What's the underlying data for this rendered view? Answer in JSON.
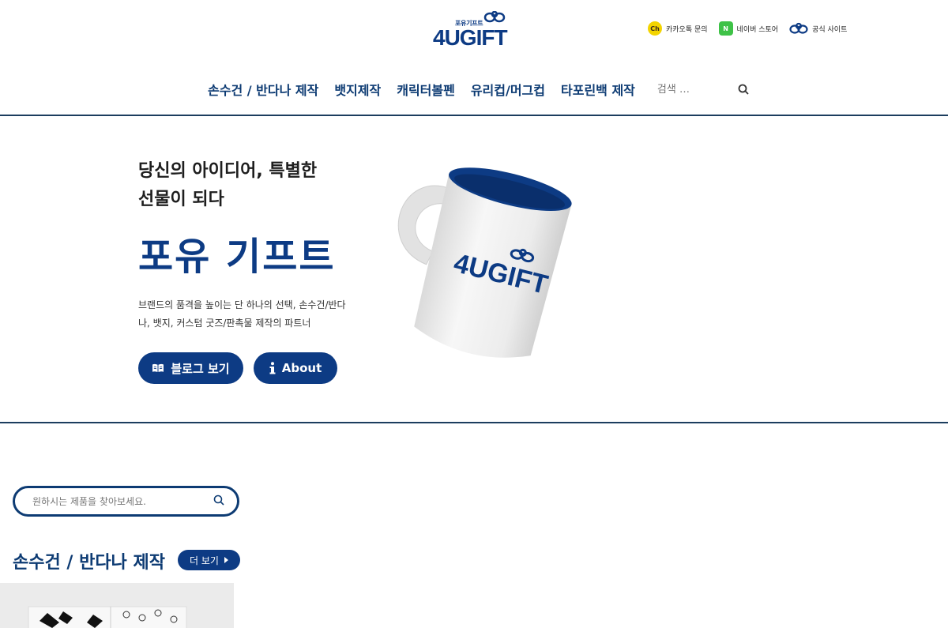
{
  "header": {
    "logo_small": "포유기프트",
    "logo_big": "4UGIFT",
    "top_links": [
      {
        "label": "카카오톡 문의",
        "icon": "kakao-channel-icon"
      },
      {
        "label": "네이버 스토어",
        "icon": "naver-store-icon"
      },
      {
        "label": "공식 사이트",
        "icon": "cloud-logo-icon"
      }
    ],
    "nav": [
      "손수건 / 반다나 제작",
      "뱃지제작",
      "캐릭터볼펜",
      "유리컵/머그컵",
      "타포린백 제작"
    ],
    "search_placeholder": "검색 …"
  },
  "hero": {
    "subtitle_line1": "당신의 아이디어, 특별한",
    "subtitle_line2": "선물이 되다",
    "title": "포유 기프트",
    "desc": "브랜드의 품격을 높이는 단 하나의 선택, 손수건/반다나, 뱃지, 커스텀 굿즈/판촉물 제작의 파트너",
    "btn_blog": "블로그 보기",
    "btn_about": "About",
    "mug_logo": "4UGIFT"
  },
  "product_search": {
    "placeholder": "원하시는 제품을 찾아보세요."
  },
  "section": {
    "title": "손수건 / 반다나 제작",
    "more": "더 보기"
  },
  "colors": {
    "brand": "#0d3b84",
    "nav_text": "#0d3b73",
    "divider": "#1c3d5e"
  }
}
